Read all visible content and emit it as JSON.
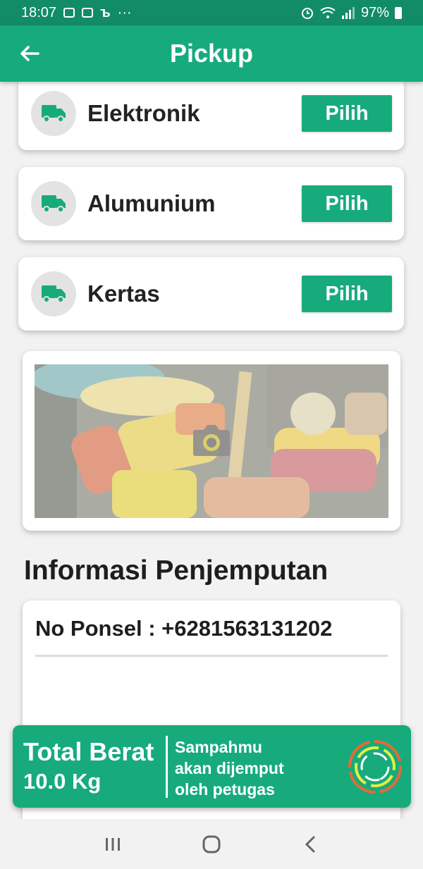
{
  "status_bar": {
    "time": "18:07",
    "dots": "···",
    "battery": "97%"
  },
  "app_bar": {
    "title": "Pickup"
  },
  "categories": [
    {
      "label": "Elektronik",
      "button": "Pilih",
      "icon": "truck-icon"
    },
    {
      "label": "Alumunium",
      "button": "Pilih",
      "icon": "truck-icon"
    },
    {
      "label": "Kertas",
      "button": "Pilih",
      "icon": "truck-icon"
    }
  ],
  "photo": {
    "icon": "camera-icon"
  },
  "info": {
    "section_title": "Informasi Penjemputan",
    "phone_label": "No Ponsel : ",
    "phone_value": "+6281563131202"
  },
  "total": {
    "label": "Total Berat",
    "value": "10.0 Kg",
    "note_lines": [
      "Sampahmu",
      "akan dijemput",
      "oleh petugas"
    ]
  },
  "colors": {
    "primary": "#17ab7c",
    "status_bar": "#128c66",
    "spinner_orange": "#e36b3a",
    "spinner_yellow": "#e4ef3e"
  }
}
